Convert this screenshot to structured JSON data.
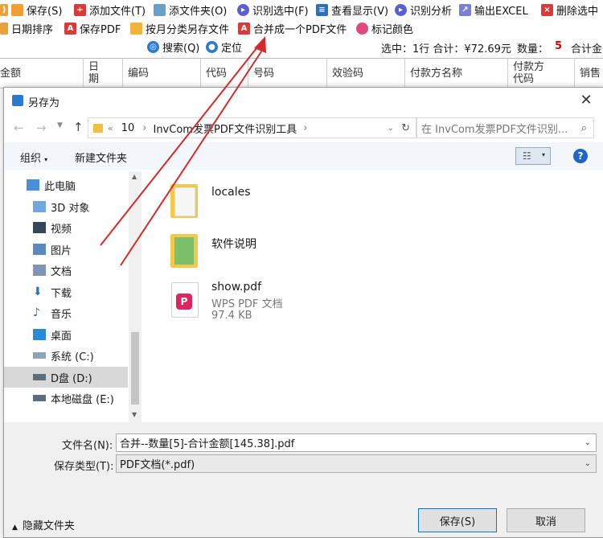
{
  "toolbar1": {
    "b0": "保存(S)",
    "b1": "添加文件(T)",
    "b2": "添文件夹(O)",
    "b3": "识别选中(F)",
    "b4": "查看显示(V)",
    "b5": "识别分析",
    "b6": "输出EXCEL",
    "b7": "删除选中"
  },
  "toolbar2": {
    "b0": "日期排序",
    "b1": "保存PDF",
    "b2": "按月分类另存文件",
    "b3": "合并成一个PDF文件",
    "b4": "标记颜色"
  },
  "toolbar3": {
    "search": "搜索(Q)",
    "locate": "定位",
    "selected_text": "选中：1行 合计：¥72.69元",
    "count_label": "数量：",
    "count_value": "5",
    "total_label": "合计金"
  },
  "grid_headers": [
    "金额",
    "日期",
    "编码",
    "代码",
    "号码",
    "效验码",
    "付款方名称",
    "付款方代码",
    "销售"
  ],
  "dialog": {
    "title": "另存为",
    "address": {
      "seg1": "10",
      "seg2": "InvCom发票PDF文件识别工具"
    },
    "search_placeholder": "在 InvCom发票PDF文件识别...",
    "organize": "组织",
    "new_folder": "新建文件夹",
    "nav_items": [
      {
        "label": "此电脑",
        "icon": "computer-icon"
      },
      {
        "label": "3D 对象",
        "icon": "3d-objects-icon"
      },
      {
        "label": "视频",
        "icon": "video-icon"
      },
      {
        "label": "图片",
        "icon": "pictures-icon"
      },
      {
        "label": "文档",
        "icon": "documents-icon"
      },
      {
        "label": "下载",
        "icon": "download-icon"
      },
      {
        "label": "音乐",
        "icon": "music-icon"
      },
      {
        "label": "桌面",
        "icon": "desktop-icon"
      },
      {
        "label": "系统 (C:)",
        "icon": "drive-icon"
      },
      {
        "label": "D盘 (D:)",
        "icon": "drive-icon"
      },
      {
        "label": "本地磁盘 (E:)",
        "icon": "drive-icon"
      }
    ],
    "files": [
      {
        "name": "locales",
        "type": "",
        "size": "",
        "icon": "folder-icon"
      },
      {
        "name": "软件说明",
        "type": "",
        "size": "",
        "icon": "folder-icon"
      },
      {
        "name": "show.pdf",
        "type": "WPS PDF 文档",
        "size": "97.4 KB",
        "icon": "pdf-icon"
      }
    ],
    "filename_label": "文件名(N):",
    "filename_value": "合并--数量[5]-合计金额[145.38].pdf",
    "filetype_label": "保存类型(T):",
    "filetype_value": "PDF文档(*.pdf)",
    "hide_folders": "隐藏文件夹",
    "save_button": "保存(S)",
    "cancel_button": "取消"
  },
  "colors": {
    "accent": "#0078d7",
    "arrow": "#d42a2a",
    "count": "#e00000"
  }
}
